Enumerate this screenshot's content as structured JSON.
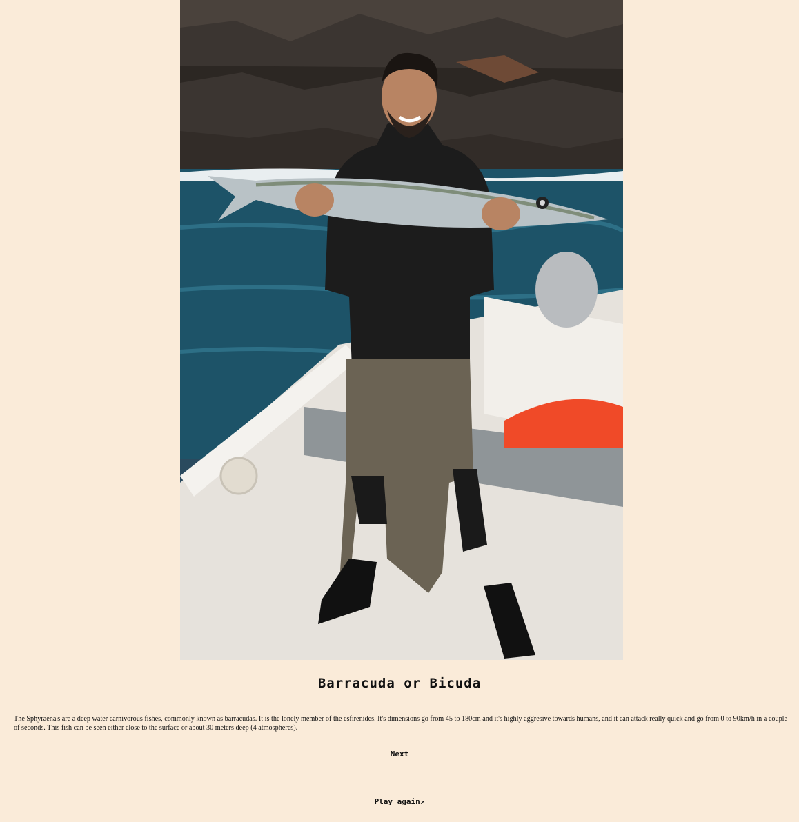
{
  "fish": {
    "name": "Barracuda or Bicuda",
    "description": "The Sphyraena's are a deep water carnivorous fishes, commonly known as barracudas. It is the lonely member of the esfirenides. It's dimensions go from 45 to 180cm and it's highly aggresive towards humans, and it can attack really quick and go from 0 to 90km/h in a couple of seconds. This fish can be seen either close to the surface or about 30 meters deep (4 atmospheres)."
  },
  "controls": {
    "next_label": "Next",
    "play_again_label": "Play again↗"
  },
  "colors": {
    "background": "#faebd9",
    "text": "#111111"
  }
}
